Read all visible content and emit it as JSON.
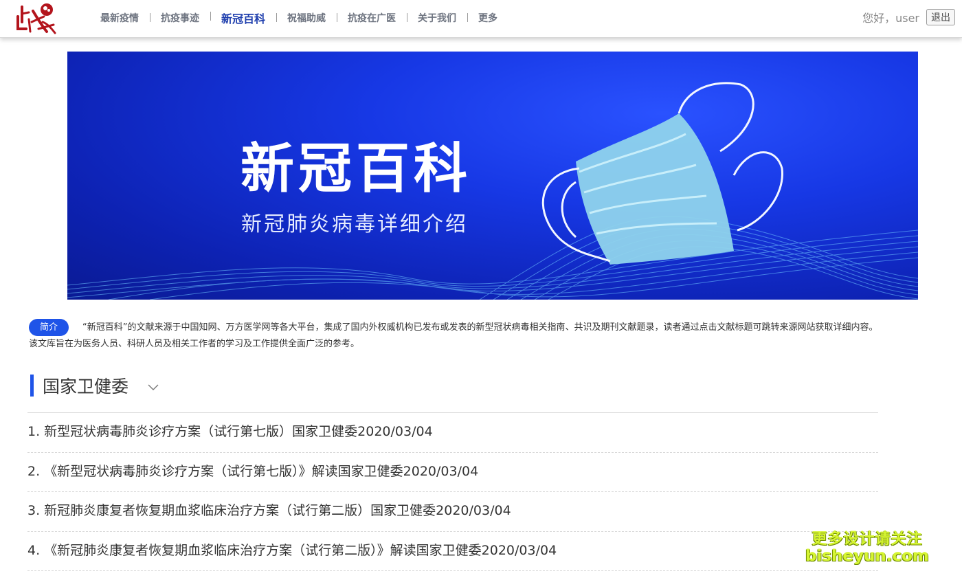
{
  "header": {
    "logo_text": "战疫",
    "nav": [
      {
        "label": "最新疫情",
        "active": false
      },
      {
        "label": "抗疫事迹",
        "active": false
      },
      {
        "label": "新冠百科",
        "active": true
      },
      {
        "label": "祝福助威",
        "active": false
      },
      {
        "label": "抗疫在广医",
        "active": false
      },
      {
        "label": "关于我们",
        "active": false
      },
      {
        "label": "更多",
        "active": false
      }
    ],
    "greeting": "您好，user",
    "logout_label": "退出"
  },
  "banner": {
    "title": "新冠百科",
    "subtitle": "新冠肺炎病毒详细介绍"
  },
  "intro": {
    "badge": "简介",
    "text": "“新冠百科”的文献来源于中国知网、万方医学网等各大平台，集成了国内外权威机构已发布或发表的新型冠状病毒相关指南、共识及期刊文献题录，读者通过点击文献标题可跳转来源网站获取详细内容。该文库旨在为医务人员、科研人员及相关工作者的学习及工作提供全面广泛的参考。"
  },
  "section": {
    "title": "国家卫健委",
    "items": [
      "1. 新型冠状病毒肺炎诊疗方案（试行第七版）国家卫健委2020/03/04",
      "2. 《新型冠状病毒肺炎诊疗方案（试行第七版）》解读国家卫健委2020/03/04",
      "3. 新冠肺炎康复者恢复期血浆临床治疗方案（试行第二版）国家卫健委2020/03/04",
      "4. 《新冠肺炎康复者恢复期血浆临床治疗方案（试行第二版）》解读国家卫健委2020/03/04"
    ]
  },
  "watermark": {
    "line1": "更多设计请关注",
    "line2": "bisheyun.com"
  },
  "colors": {
    "accent": "#1f54e8",
    "nav_active": "#1f3fae",
    "banner_bg": "#1738e5",
    "watermark": "#d6f533"
  }
}
